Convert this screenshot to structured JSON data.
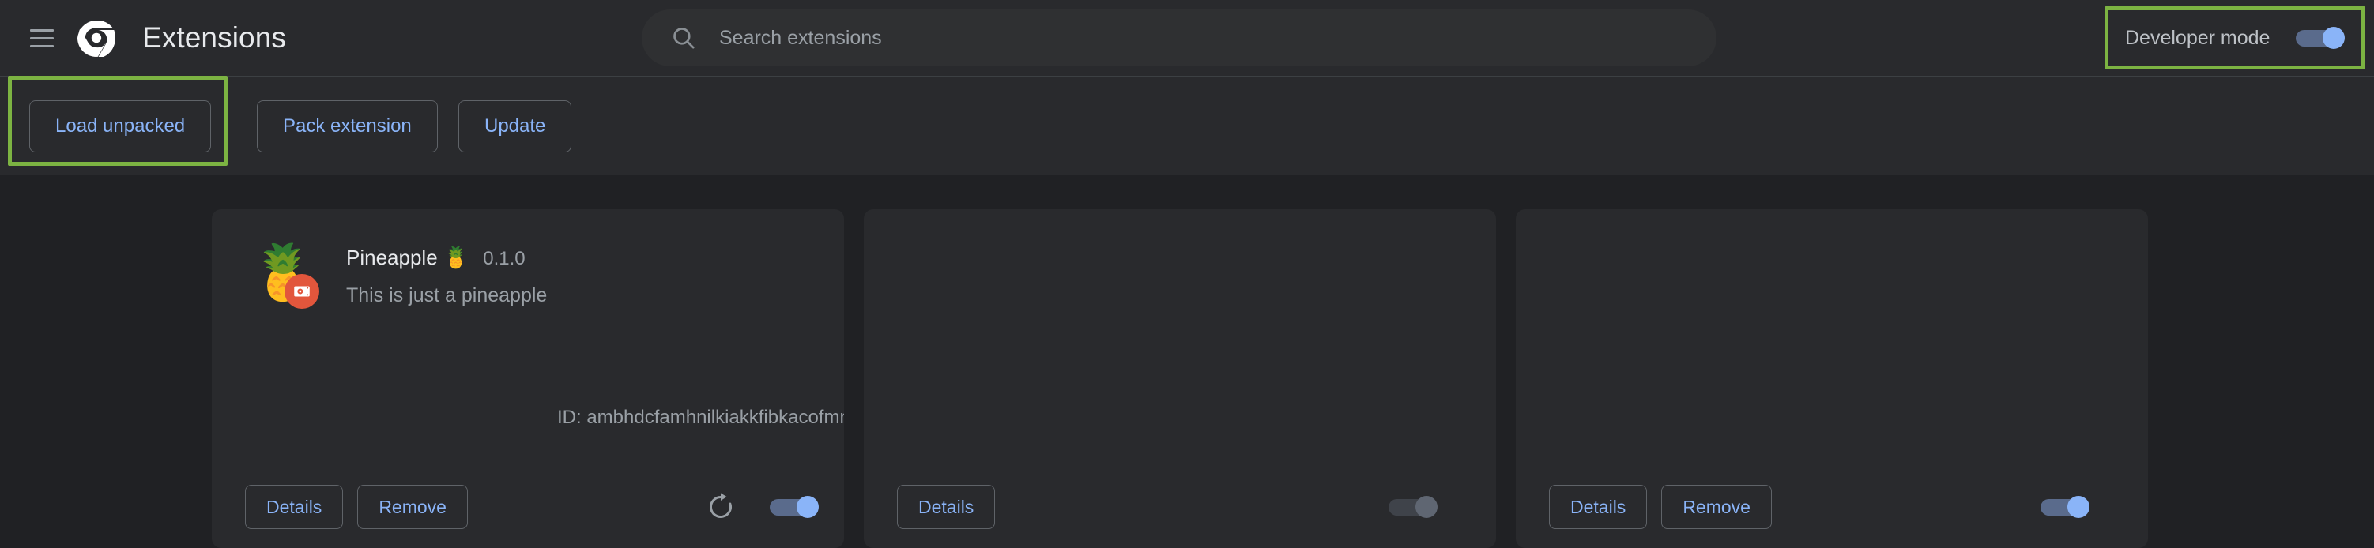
{
  "header": {
    "title": "Extensions",
    "menu_icon": "hamburger-menu-icon",
    "logo_icon": "chrome-logo-icon"
  },
  "search": {
    "placeholder": "Search extensions",
    "value": "",
    "icon": "search-icon"
  },
  "developer_mode": {
    "label": "Developer mode",
    "enabled": true,
    "highlighted": true,
    "highlight_color": "#7cb342"
  },
  "toolbar": {
    "buttons": [
      {
        "label": "Load unpacked",
        "highlighted": true
      },
      {
        "label": "Pack extension",
        "highlighted": false
      },
      {
        "label": "Update",
        "highlighted": false
      }
    ],
    "highlight_color": "#7cb342"
  },
  "extensions": [
    {
      "name": "Pineapple 🍍",
      "version": "0.1.0",
      "description": "This is just a pineapple",
      "id_label": "ID: ambhdcfamhnilkiakkfibkacofmnpomc",
      "icon_emoji": "🍍",
      "unpacked_badge": true,
      "details_label": "Details",
      "remove_label": "Remove",
      "has_remove": true,
      "has_reload": true,
      "reload_icon": "reload-icon",
      "enabled": true
    },
    {
      "name": "",
      "version": "",
      "description": "",
      "id_label": "",
      "icon_emoji": "",
      "unpacked_badge": false,
      "details_label": "Details",
      "remove_label": "",
      "has_remove": false,
      "has_reload": false,
      "reload_icon": "",
      "enabled": false
    },
    {
      "name": "",
      "version": "",
      "description": "",
      "id_label": "",
      "icon_emoji": "",
      "unpacked_badge": false,
      "details_label": "Details",
      "remove_label": "Remove",
      "has_remove": true,
      "has_reload": false,
      "reload_icon": "",
      "enabled": true
    }
  ],
  "colors": {
    "background": "#202124",
    "surface": "#292a2d",
    "accent_blue": "#8ab4f8",
    "toggle_on_track": "#5a6b8c",
    "toggle_off_track": "#3f434a",
    "text_primary": "#e8eaed",
    "text_secondary": "#9aa0a6",
    "badge_orange": "#e2563c",
    "highlight_green": "#7cb342"
  }
}
